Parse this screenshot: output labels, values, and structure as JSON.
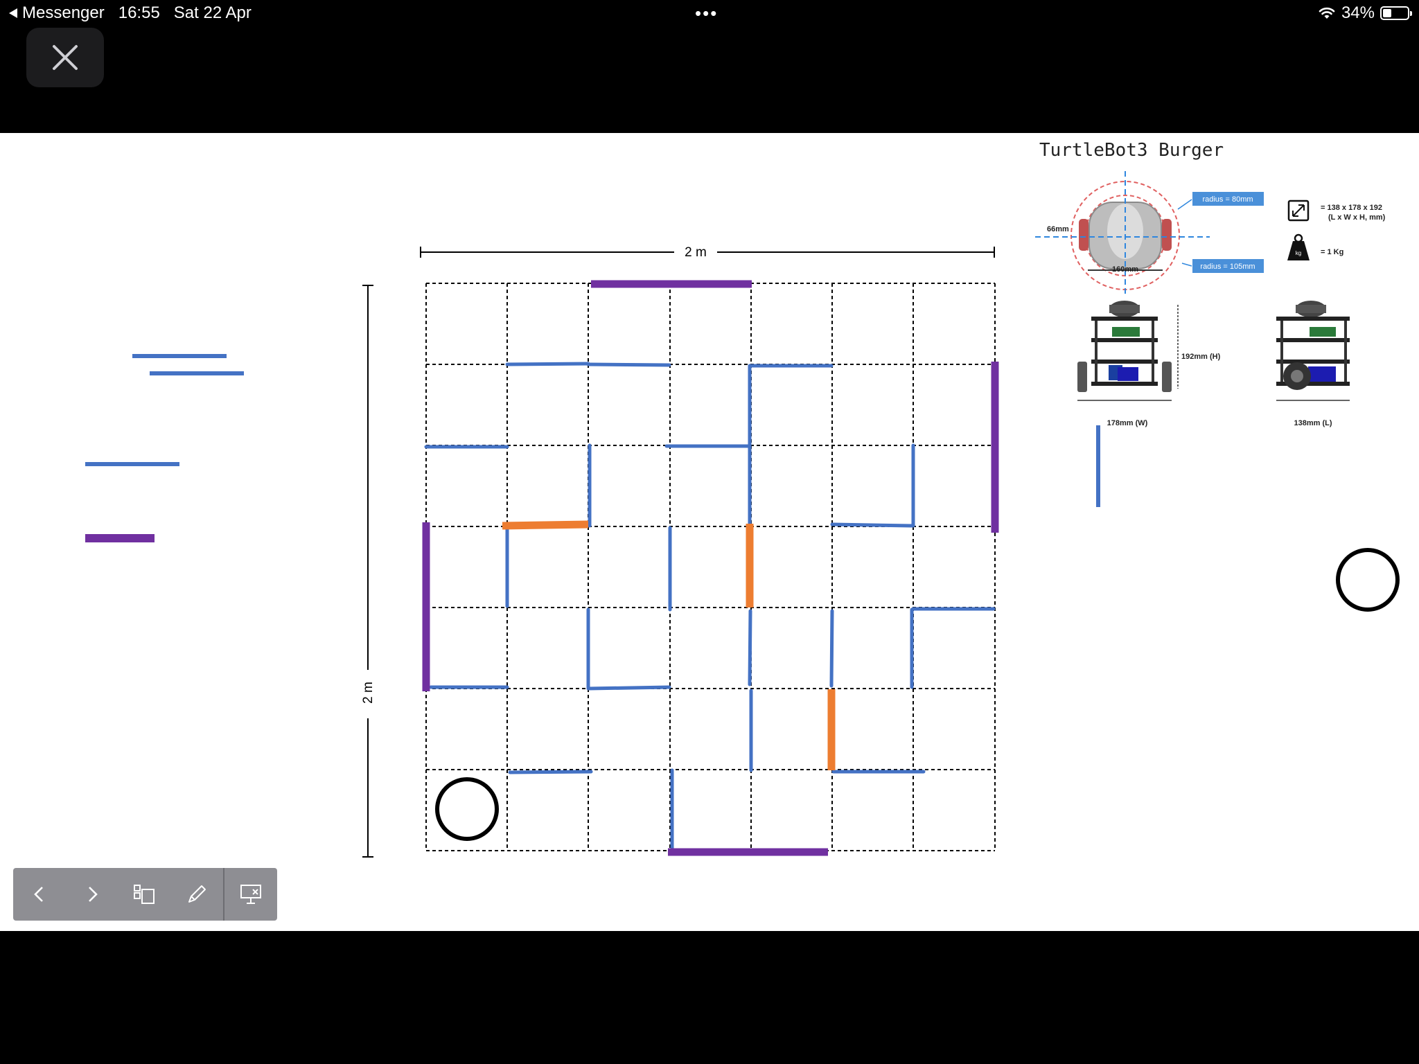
{
  "status_bar": {
    "back_app": "Messenger",
    "time": "16:55",
    "date": "Sat 22 Apr",
    "more_dots": "•••",
    "battery_percent": "34%",
    "battery_level": 0.34
  },
  "slide": {
    "top_dimension_label": "2 m",
    "side_dimension_label": "2 m",
    "robot_info": {
      "title": "TurtleBot3 Burger",
      "radius_small_label": "radius = 80mm",
      "radius_large_label": "radius = 105mm",
      "width_66_label": "66mm",
      "width_160_label": "160mm",
      "dimensions_line1": "= 138 x 178 x 192",
      "dimensions_line2": "(L x W x H, mm)",
      "weight_label": "= 1 Kg",
      "weight_icon_label": "kg",
      "height_label": "192mm (H)",
      "width_label": "178mm (W)",
      "length_label": "138mm (L)"
    }
  },
  "colors": {
    "wall_blue": "#4472c4",
    "wall_purple": "#7030a0",
    "wall_orange": "#ed7d31",
    "grid": "#000000"
  },
  "toolbar": {
    "icons": [
      "chevron-left-icon",
      "chevron-right-icon",
      "slides-overview-icon",
      "pen-icon",
      "end-presentation-icon"
    ]
  }
}
